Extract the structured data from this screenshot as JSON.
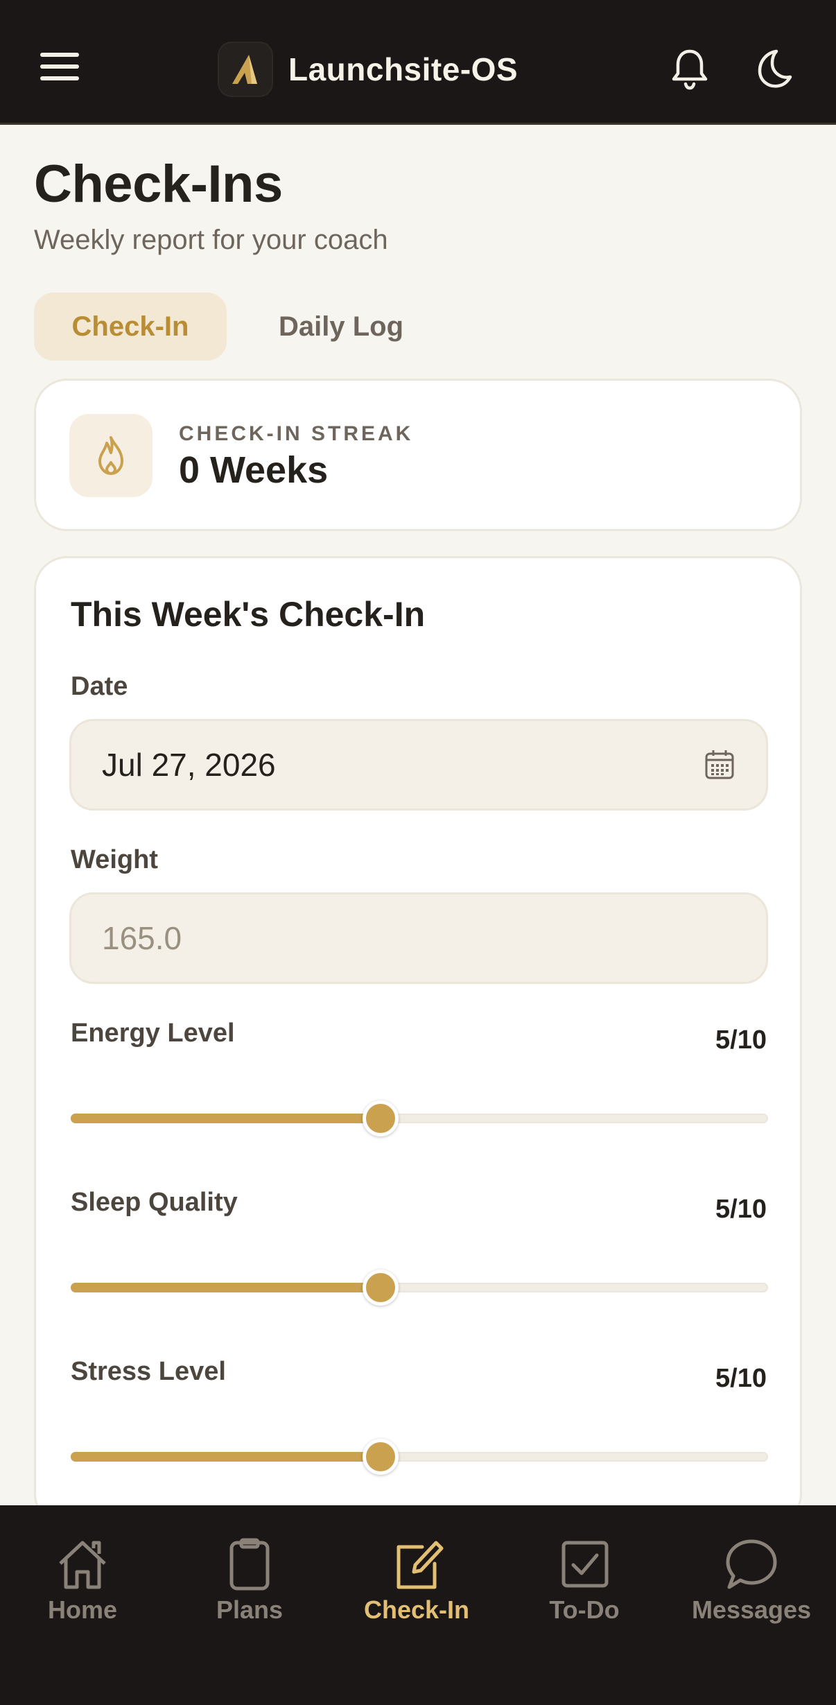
{
  "header": {
    "app_title": "Launchsite-OS",
    "menu_icon": "hamburger-menu-icon",
    "notifications_icon": "bell-icon",
    "theme_icon": "moon-icon"
  },
  "page": {
    "title": "Check-Ins",
    "subtitle": "Weekly report for your coach"
  },
  "tabs": [
    {
      "label": "Check-In",
      "active": true
    },
    {
      "label": "Daily Log",
      "active": false
    }
  ],
  "streak": {
    "label": "CHECK-IN STREAK",
    "value": "0 Weeks",
    "icon": "flame-icon"
  },
  "form": {
    "title": "This Week's Check-In",
    "date": {
      "label": "Date",
      "value": "Jul 27, 2026"
    },
    "weight": {
      "label": "Weight",
      "placeholder": "165.0"
    },
    "sliders": [
      {
        "label": "Energy Level",
        "display": "5/10",
        "value": 5,
        "max": 10
      },
      {
        "label": "Sleep Quality",
        "display": "5/10",
        "value": 5,
        "max": 10
      },
      {
        "label": "Stress Level",
        "display": "5/10",
        "value": 5,
        "max": 10
      }
    ]
  },
  "bottom_nav": [
    {
      "label": "Home",
      "icon": "home-icon",
      "active": false
    },
    {
      "label": "Plans",
      "icon": "clipboard-icon",
      "active": false
    },
    {
      "label": "Check-In",
      "icon": "edit-square-icon",
      "active": true
    },
    {
      "label": "To-Do",
      "icon": "checkbox-icon",
      "active": false
    },
    {
      "label": "Messages",
      "icon": "chat-bubble-icon",
      "active": false
    }
  ],
  "colors": {
    "accent": "#c9a14f",
    "accent_text": "#b98d33",
    "header_bg": "#1b1716",
    "page_bg": "#f7f5f0"
  }
}
